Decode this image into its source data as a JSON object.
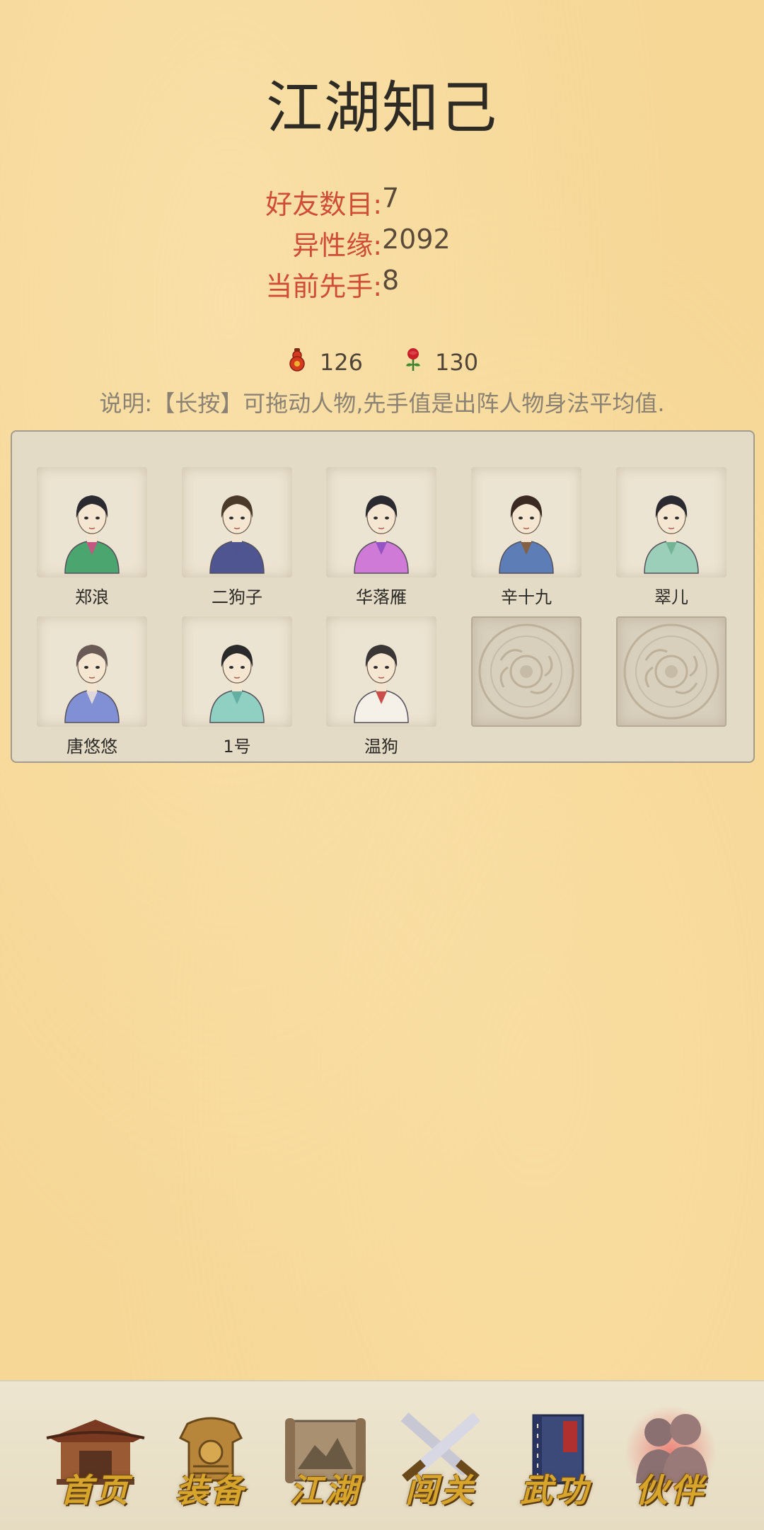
{
  "page": {
    "title": "江湖知己"
  },
  "stats": [
    {
      "label": "好友数目:",
      "value": "7"
    },
    {
      "label": "异性缘:",
      "value": "2092"
    },
    {
      "label": "当前先手:",
      "value": "8"
    }
  ],
  "currency": [
    {
      "icon": "red-gourd-icon",
      "value": "126"
    },
    {
      "icon": "rose-icon",
      "value": "130"
    }
  ],
  "note": "说明:【长按】可拖动人物,先手值是出阵人物身法平均值.",
  "companions": [
    {
      "name": "郑浪",
      "robe": "#4aa56f",
      "accent": "#d94a86",
      "hair": "#2a2a30"
    },
    {
      "name": "二狗子",
      "robe": "#4e5590",
      "accent": "#4e5590",
      "hair": "#4a3a2a"
    },
    {
      "name": "华落雁",
      "robe": "#cf7ad6",
      "accent": "#8a4ec0",
      "hair": "#2a2a30"
    },
    {
      "name": "辛十九",
      "robe": "#5c7db6",
      "accent": "#8a5a30",
      "hair": "#3a2a22"
    },
    {
      "name": "翠儿",
      "robe": "#9ccfba",
      "accent": "#6fae8f",
      "hair": "#2a2a30"
    },
    {
      "name": "唐悠悠",
      "robe": "#8190d4",
      "accent": "#f0e4dc",
      "hair": "#6a5a55"
    },
    {
      "name": "1号",
      "robe": "#8fd0c2",
      "accent": "#5aa89a",
      "hair": "#2a2a2a"
    },
    {
      "name": "温狗",
      "robe": "#f5f0e8",
      "accent": "#c23030",
      "hair": "#3a3636"
    }
  ],
  "empty_slots": 2,
  "nav": [
    {
      "label": "首页",
      "icon": "house-icon"
    },
    {
      "label": "装备",
      "icon": "armor-icon"
    },
    {
      "label": "江湖",
      "icon": "scroll-map-icon"
    },
    {
      "label": "闯关",
      "icon": "crossed-swords-icon"
    },
    {
      "label": "武功",
      "icon": "book-icon"
    },
    {
      "label": "伙伴",
      "icon": "companions-icon",
      "active": true
    }
  ]
}
